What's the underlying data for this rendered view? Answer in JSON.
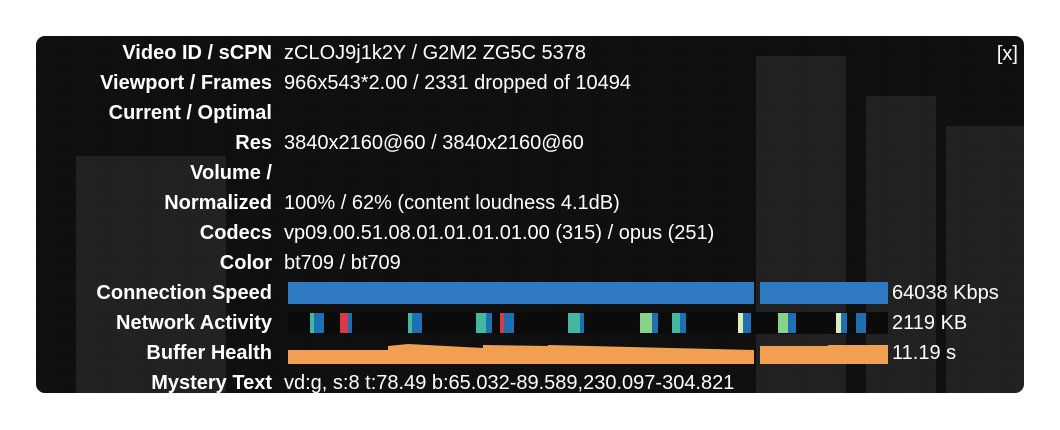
{
  "overlay": {
    "close_label": "[x]",
    "rows": {
      "video_id": {
        "label": "Video ID / sCPN",
        "value": "zCLOJ9j1k2Y / G2M2 ZG5C 5378"
      },
      "viewport": {
        "label": "Viewport / Frames",
        "value": "966x543*2.00 / 2331 dropped of 10494"
      },
      "current": {
        "label": "Current / Optimal",
        "value": ""
      },
      "res": {
        "label": "Res",
        "value": "3840x2160@60 / 3840x2160@60"
      },
      "volume": {
        "label": "Volume /",
        "value": ""
      },
      "normalized": {
        "label": "Normalized",
        "value": "100% / 62% (content loudness 4.1dB)"
      },
      "codecs": {
        "label": "Codecs",
        "value": "vp09.00.51.08.01.01.01.01.00 (315) / opus (251)"
      },
      "color": {
        "label": "Color",
        "value": "bt709 / bt709"
      },
      "connection": {
        "label": "Connection Speed",
        "value": "64038 Kbps"
      },
      "network": {
        "label": "Network Activity",
        "value": "2119 KB"
      },
      "buffer": {
        "label": "Buffer Health",
        "value": "11.19 s"
      },
      "mystery": {
        "label": "Mystery Text",
        "value": "vd:g, s:8 t:78.49 b:65.032-89.589,230.097-304.821"
      }
    }
  },
  "colors": {
    "connection_bar": "#2f7ac2",
    "buffer_bar": "#f0a050",
    "network_blue": "#1f6fb5",
    "network_teal": "#43b7a0",
    "network_green": "#8ad18c",
    "network_red": "#d83a4a",
    "network_light": "#d8f0b0"
  }
}
